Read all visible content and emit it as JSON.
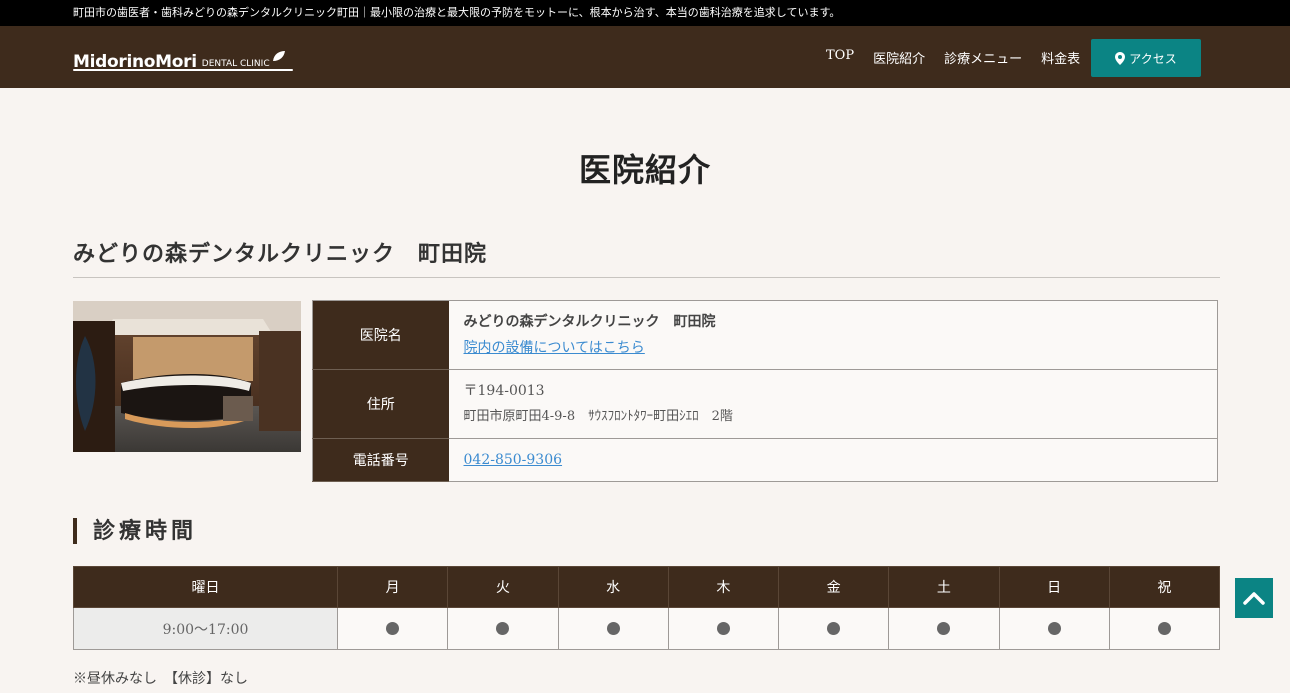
{
  "topbar": {
    "text": "町田市の歯医者・歯科みどりの森デンタルクリニック町田｜最小限の治療と最大限の予防をモットーに、根本から治す、本当の歯科治療を追求しています。"
  },
  "header": {
    "logo_main": "MidorinoMori",
    "logo_sub": "DENTAL CLINIC",
    "nav": [
      "TOP",
      "医院紹介",
      "診療メニュー",
      "料金表"
    ],
    "access_label": "アクセス",
    "access_icon": "map-pin-icon"
  },
  "page": {
    "title": "医院紹介",
    "clinic_heading": "みどりの森デンタルクリニック　町田院"
  },
  "info": {
    "rows": [
      {
        "label": "医院名",
        "line1": "みどりの森デンタルクリニック　町田院",
        "link": "院内の設備についてはこちら"
      },
      {
        "label": "住所",
        "line1": "〒194-0013",
        "line2": "町田市原町田4-9-8　ｻｳｽﾌﾛﾝﾄﾀﾜｰ町田ｼｴﾛ　2階"
      },
      {
        "label": "電話番号",
        "link": "042-850-9306"
      }
    ]
  },
  "hours": {
    "heading": "診療時間",
    "columns": [
      "曜日",
      "月",
      "火",
      "水",
      "木",
      "金",
      "土",
      "日",
      "祝"
    ],
    "row": {
      "time": "9:00〜17:00",
      "marks": [
        "●",
        "●",
        "●",
        "●",
        "●",
        "●",
        "●",
        "●"
      ]
    },
    "note": "※昼休みなし　【休診】なし"
  },
  "colors": {
    "brand_brown": "#3e2b1c",
    "accent_teal": "#0b8484",
    "link_blue": "#3b8bd0",
    "background": "#f8f4f1"
  }
}
